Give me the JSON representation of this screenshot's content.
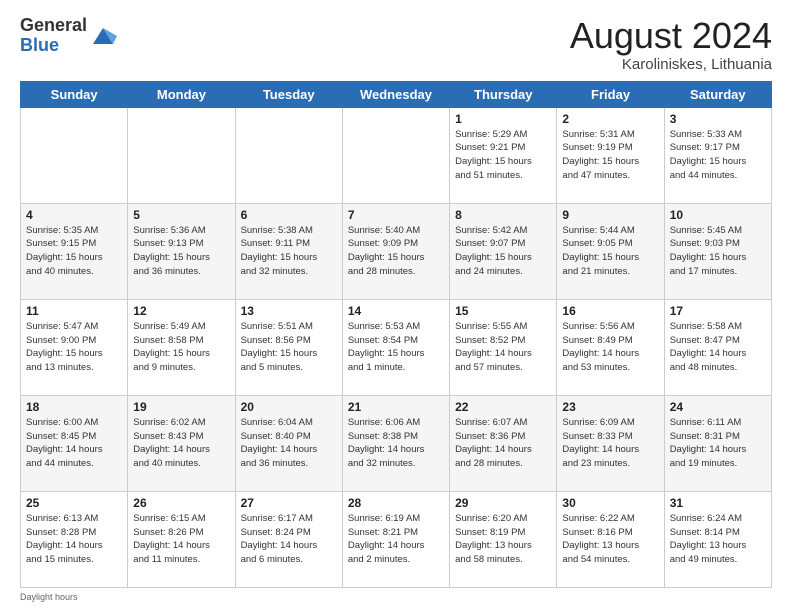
{
  "logo": {
    "general": "General",
    "blue": "Blue"
  },
  "title": {
    "month_year": "August 2024",
    "location": "Karoliniskes, Lithuania"
  },
  "days_of_week": [
    "Sunday",
    "Monday",
    "Tuesday",
    "Wednesday",
    "Thursday",
    "Friday",
    "Saturday"
  ],
  "weeks": [
    [
      {
        "day": "",
        "info": ""
      },
      {
        "day": "",
        "info": ""
      },
      {
        "day": "",
        "info": ""
      },
      {
        "day": "",
        "info": ""
      },
      {
        "day": "1",
        "info": "Sunrise: 5:29 AM\nSunset: 9:21 PM\nDaylight: 15 hours\nand 51 minutes."
      },
      {
        "day": "2",
        "info": "Sunrise: 5:31 AM\nSunset: 9:19 PM\nDaylight: 15 hours\nand 47 minutes."
      },
      {
        "day": "3",
        "info": "Sunrise: 5:33 AM\nSunset: 9:17 PM\nDaylight: 15 hours\nand 44 minutes."
      }
    ],
    [
      {
        "day": "4",
        "info": "Sunrise: 5:35 AM\nSunset: 9:15 PM\nDaylight: 15 hours\nand 40 minutes."
      },
      {
        "day": "5",
        "info": "Sunrise: 5:36 AM\nSunset: 9:13 PM\nDaylight: 15 hours\nand 36 minutes."
      },
      {
        "day": "6",
        "info": "Sunrise: 5:38 AM\nSunset: 9:11 PM\nDaylight: 15 hours\nand 32 minutes."
      },
      {
        "day": "7",
        "info": "Sunrise: 5:40 AM\nSunset: 9:09 PM\nDaylight: 15 hours\nand 28 minutes."
      },
      {
        "day": "8",
        "info": "Sunrise: 5:42 AM\nSunset: 9:07 PM\nDaylight: 15 hours\nand 24 minutes."
      },
      {
        "day": "9",
        "info": "Sunrise: 5:44 AM\nSunset: 9:05 PM\nDaylight: 15 hours\nand 21 minutes."
      },
      {
        "day": "10",
        "info": "Sunrise: 5:45 AM\nSunset: 9:03 PM\nDaylight: 15 hours\nand 17 minutes."
      }
    ],
    [
      {
        "day": "11",
        "info": "Sunrise: 5:47 AM\nSunset: 9:00 PM\nDaylight: 15 hours\nand 13 minutes."
      },
      {
        "day": "12",
        "info": "Sunrise: 5:49 AM\nSunset: 8:58 PM\nDaylight: 15 hours\nand 9 minutes."
      },
      {
        "day": "13",
        "info": "Sunrise: 5:51 AM\nSunset: 8:56 PM\nDaylight: 15 hours\nand 5 minutes."
      },
      {
        "day": "14",
        "info": "Sunrise: 5:53 AM\nSunset: 8:54 PM\nDaylight: 15 hours\nand 1 minute."
      },
      {
        "day": "15",
        "info": "Sunrise: 5:55 AM\nSunset: 8:52 PM\nDaylight: 14 hours\nand 57 minutes."
      },
      {
        "day": "16",
        "info": "Sunrise: 5:56 AM\nSunset: 8:49 PM\nDaylight: 14 hours\nand 53 minutes."
      },
      {
        "day": "17",
        "info": "Sunrise: 5:58 AM\nSunset: 8:47 PM\nDaylight: 14 hours\nand 48 minutes."
      }
    ],
    [
      {
        "day": "18",
        "info": "Sunrise: 6:00 AM\nSunset: 8:45 PM\nDaylight: 14 hours\nand 44 minutes."
      },
      {
        "day": "19",
        "info": "Sunrise: 6:02 AM\nSunset: 8:43 PM\nDaylight: 14 hours\nand 40 minutes."
      },
      {
        "day": "20",
        "info": "Sunrise: 6:04 AM\nSunset: 8:40 PM\nDaylight: 14 hours\nand 36 minutes."
      },
      {
        "day": "21",
        "info": "Sunrise: 6:06 AM\nSunset: 8:38 PM\nDaylight: 14 hours\nand 32 minutes."
      },
      {
        "day": "22",
        "info": "Sunrise: 6:07 AM\nSunset: 8:36 PM\nDaylight: 14 hours\nand 28 minutes."
      },
      {
        "day": "23",
        "info": "Sunrise: 6:09 AM\nSunset: 8:33 PM\nDaylight: 14 hours\nand 23 minutes."
      },
      {
        "day": "24",
        "info": "Sunrise: 6:11 AM\nSunset: 8:31 PM\nDaylight: 14 hours\nand 19 minutes."
      }
    ],
    [
      {
        "day": "25",
        "info": "Sunrise: 6:13 AM\nSunset: 8:28 PM\nDaylight: 14 hours\nand 15 minutes."
      },
      {
        "day": "26",
        "info": "Sunrise: 6:15 AM\nSunset: 8:26 PM\nDaylight: 14 hours\nand 11 minutes."
      },
      {
        "day": "27",
        "info": "Sunrise: 6:17 AM\nSunset: 8:24 PM\nDaylight: 14 hours\nand 6 minutes."
      },
      {
        "day": "28",
        "info": "Sunrise: 6:19 AM\nSunset: 8:21 PM\nDaylight: 14 hours\nand 2 minutes."
      },
      {
        "day": "29",
        "info": "Sunrise: 6:20 AM\nSunset: 8:19 PM\nDaylight: 13 hours\nand 58 minutes."
      },
      {
        "day": "30",
        "info": "Sunrise: 6:22 AM\nSunset: 8:16 PM\nDaylight: 13 hours\nand 54 minutes."
      },
      {
        "day": "31",
        "info": "Sunrise: 6:24 AM\nSunset: 8:14 PM\nDaylight: 13 hours\nand 49 minutes."
      }
    ]
  ],
  "footer": {
    "note": "Daylight hours"
  }
}
